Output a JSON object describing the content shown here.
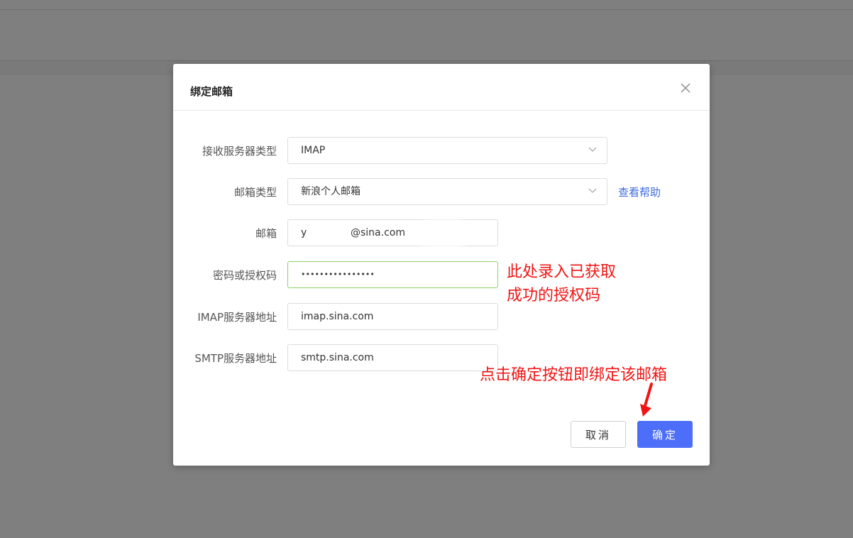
{
  "dialog": {
    "title": "绑定邮箱",
    "close_icon": "close-icon"
  },
  "form": {
    "receive_server_type": {
      "label": "接收服务器类型",
      "value": "IMAP"
    },
    "mailbox_type": {
      "label": "邮箱类型",
      "value": "新浪个人邮箱",
      "help_link": "查看帮助"
    },
    "email": {
      "label": "邮箱",
      "prefix": "y",
      "suffix": "@sina.com"
    },
    "password": {
      "label": "密码或授权码",
      "value": "••••••••••••••••"
    },
    "imap_server": {
      "label": "IMAP服务器地址",
      "value": "imap.sina.com"
    },
    "smtp_server": {
      "label": "SMTP服务器地址",
      "value": "smtp.sina.com"
    }
  },
  "buttons": {
    "cancel": "取消",
    "ok": "确定"
  },
  "annotations": {
    "password_note_line1": "此处录入已获取",
    "password_note_line2": "成功的授权码",
    "ok_note": "点击确定按钮即绑定该邮箱"
  },
  "colors": {
    "primary": "#4c6ef8",
    "focus_border": "#8fd16a",
    "annotation": "#f01515",
    "link": "#3e6bde"
  }
}
